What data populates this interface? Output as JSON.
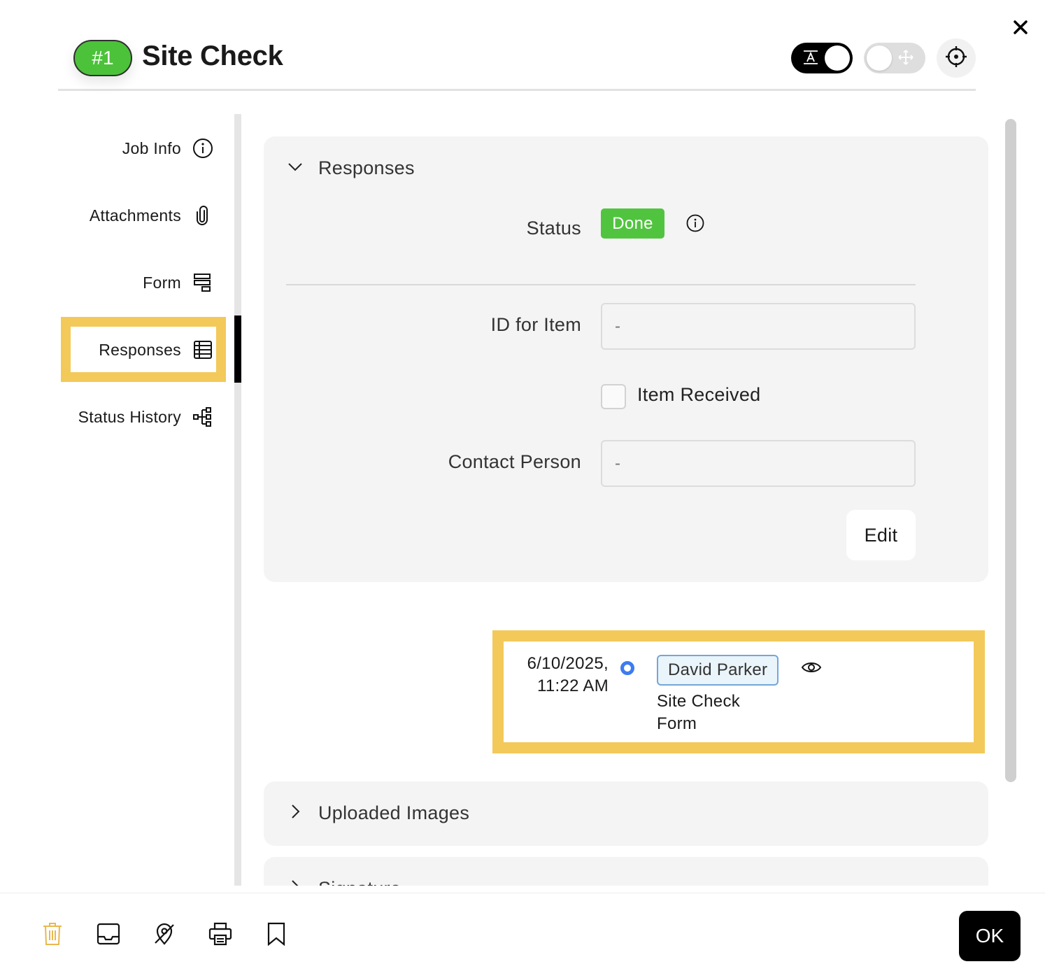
{
  "header": {
    "job_number": "#1",
    "title": "Site Check",
    "text_toggle_icon": "text-toggle-icon",
    "move_toggle_icon": "move-icon",
    "locate_icon": "crosshair-icon"
  },
  "sidebar": {
    "items": [
      {
        "label": "Job Info",
        "icon": "info-icon"
      },
      {
        "label": "Attachments",
        "icon": "paperclip-icon"
      },
      {
        "label": "Form",
        "icon": "form-icon"
      },
      {
        "label": "Responses",
        "icon": "table-icon",
        "active": true
      },
      {
        "label": "Status History",
        "icon": "hierarchy-icon"
      }
    ]
  },
  "responses_panel": {
    "title": "Responses",
    "status_label": "Status",
    "status_value": "Done",
    "fields": [
      {
        "label": "ID for Item",
        "value": "-"
      },
      {
        "label": "Contact Person",
        "value": "-"
      }
    ],
    "checkbox_label": "Item Received",
    "checkbox_checked": false,
    "edit_label": "Edit"
  },
  "history_entry": {
    "date": "6/10/2025,",
    "time": "11:22 AM",
    "user": "David Parker",
    "form": "Site Check Form"
  },
  "sections": {
    "images": "Uploaded Images",
    "signature": "Signature"
  },
  "footer": {
    "tools": [
      "trash-icon",
      "inbox-icon",
      "map-pin-icon",
      "printer-icon",
      "bookmark-icon"
    ],
    "ok_label": "OK"
  },
  "colors": {
    "accent_green": "#4cc23a",
    "highlight_yellow": "#f3c95a",
    "timeline_blue": "#3d7bf0",
    "trash_orange": "#e9b84f"
  }
}
